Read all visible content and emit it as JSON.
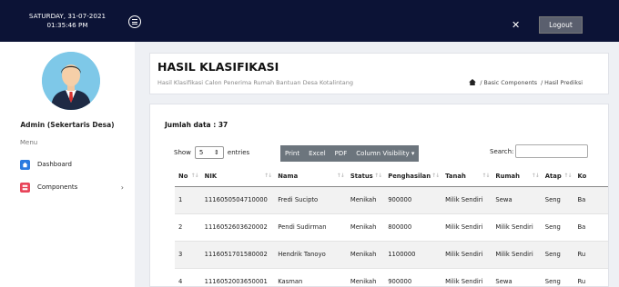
{
  "topbar": {
    "date": "SATURDAY, 31-07-2021",
    "time": "01:35:46 PM",
    "logout_label": "Logout"
  },
  "sidebar": {
    "admin_name": "Admin (Sekertaris Desa)",
    "menu_label": "Menu",
    "items": [
      {
        "label": "Dashboard",
        "icon": "home-icon"
      },
      {
        "label": "Components",
        "icon": "components-icon",
        "chevron": "›"
      }
    ]
  },
  "header": {
    "title": "HASIL KLASIFIKASI",
    "subtitle": "Hasil Klasifikasi Calon Penerima Rumah Bantuan Desa Kotalintang",
    "breadcrumb": [
      "/ Basic Components",
      "/ Hasil Prediksi"
    ]
  },
  "content": {
    "jumlah": "Jumlah data : 37",
    "show_label": "Show",
    "entries_value": "5",
    "entries_label": "entries",
    "buttons": [
      "Print",
      "Excel",
      "PDF",
      "Column Visibility ▾"
    ],
    "search_label": "Search:",
    "search_value": ""
  },
  "table": {
    "headers": [
      "No",
      "NIK",
      "Nama",
      "Status",
      "Penghasilan",
      "Tanah",
      "Rumah",
      "Atap",
      "Ko"
    ],
    "rows": [
      [
        "1",
        "1116050504710000",
        "Fredi Sucipto",
        "Menikah",
        "900000",
        "Milik Sendiri",
        "Sewa",
        "Seng",
        "Ba"
      ],
      [
        "2",
        "1116052603620002",
        "Pendi Sudirman",
        "Menikah",
        "800000",
        "Milik Sendiri",
        "Milik Sendiri",
        "Seng",
        "Ba"
      ],
      [
        "3",
        "1116051701580002",
        "Hendrik Tanoyo",
        "Menikah",
        "1100000",
        "Milik Sendiri",
        "Milik Sendiri",
        "Seng",
        "Ru"
      ],
      [
        "4",
        "1116052003650001",
        "Kasman",
        "Menikah",
        "900000",
        "Milik Sendiri",
        "Sewa",
        "Seng",
        "Ru"
      ]
    ]
  },
  "colors": {
    "topbar": "#0c1336",
    "dashboard_icon": "#2a7be0",
    "components_icon": "#e8455a",
    "button_group": "#6c757d"
  }
}
